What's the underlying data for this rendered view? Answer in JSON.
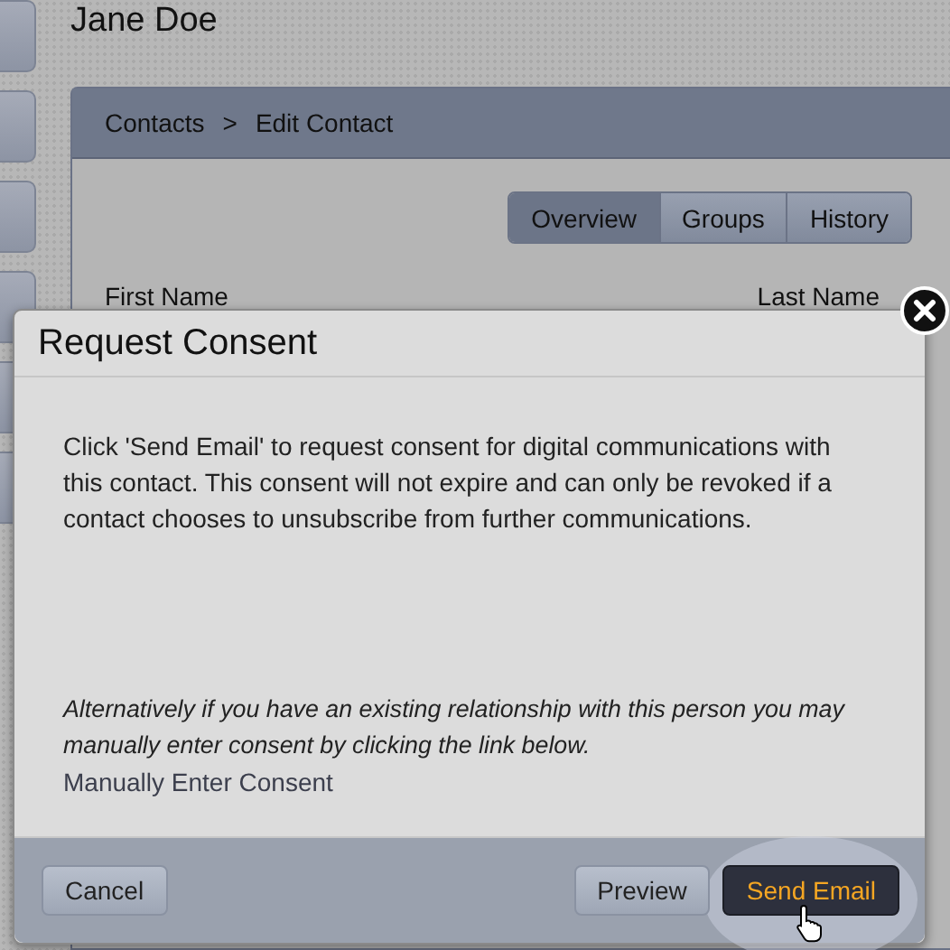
{
  "page": {
    "title": "Jane Doe"
  },
  "breadcrumb": [
    "Contacts",
    ">",
    "Edit Contact"
  ],
  "tabs": [
    {
      "label": "Overview",
      "selected": true
    },
    {
      "label": "Groups",
      "selected": false
    },
    {
      "label": "History",
      "selected": false
    }
  ],
  "fields": [
    "First Name",
    "Last Name"
  ],
  "dialog": {
    "title": "Request Consent",
    "message": "Click 'Send Email' to request consent for digital communications with this contact. This consent will not expire and can only be revoked if a contact chooses to unsubscribe from further communications.",
    "note": "Alternatively if you have an existing relationship with this person you may manually enter consent by clicking the link below.",
    "link": "Manually Enter Consent",
    "buttons": [
      {
        "label": "Cancel",
        "kind": "secondary"
      },
      {
        "label": "Preview",
        "kind": "secondary"
      },
      {
        "label": "Send Email",
        "kind": "primary"
      }
    ]
  }
}
